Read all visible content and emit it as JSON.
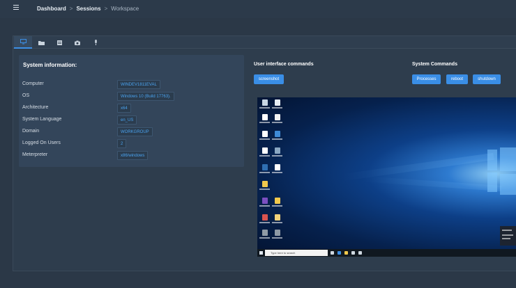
{
  "breadcrumb": {
    "dashboard": "Dashboard",
    "sessions": "Sessions",
    "workspace": "Workspace",
    "separator": ">"
  },
  "tabs": [
    {
      "icon": "monitor-icon",
      "active": true
    },
    {
      "icon": "folder-icon",
      "active": false
    },
    {
      "icon": "list-icon",
      "active": false
    },
    {
      "icon": "camera-icon",
      "active": false
    },
    {
      "icon": "microphone-icon",
      "active": false
    }
  ],
  "sysinfo": {
    "title": "System information:",
    "rows": [
      {
        "label": "Computer",
        "value": "WINDEV1811EVAL"
      },
      {
        "label": "OS",
        "value": "Windows 10 (Build 17763)."
      },
      {
        "label": "Architecture",
        "value": "x64"
      },
      {
        "label": "System Language",
        "value": "en_US"
      },
      {
        "label": "Domain",
        "value": "WORKGROUP"
      },
      {
        "label": "Logged On Users",
        "value": "2"
      },
      {
        "label": "Meterpreter",
        "value": "x86/windows"
      }
    ]
  },
  "ui_commands": {
    "title": "User interface commands",
    "screenshot_label": "screenshot"
  },
  "system_commands": {
    "title": "System Commands",
    "processes_label": "Processes",
    "reboot_label": "reboot",
    "shutdown_label": "shutdown"
  },
  "desktop": {
    "search_placeholder": "Type here to search"
  },
  "colors": {
    "accent": "#3a8ee6",
    "background": "#2b3847",
    "panel": "#33455a",
    "value_text": "#4aa3f0"
  }
}
